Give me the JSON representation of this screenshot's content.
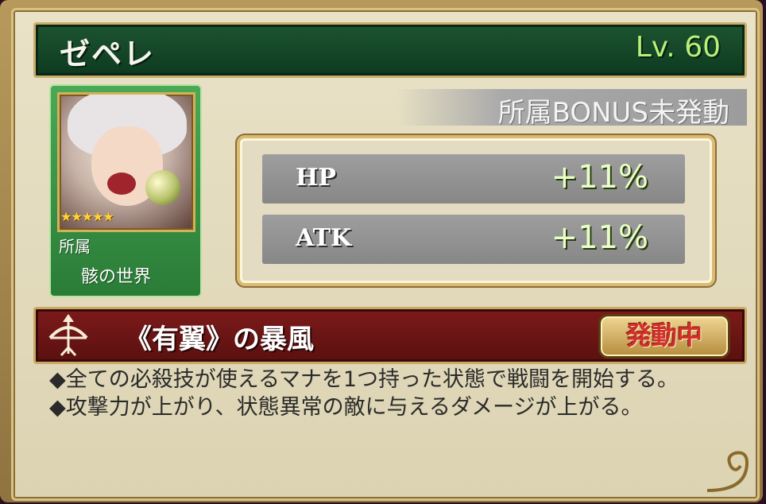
{
  "character": {
    "name": "ゼペレ",
    "level": "Lv. 60",
    "rarity_stars": "★★★★★",
    "affiliation_label": "所属",
    "affiliation_value": "骸の世界"
  },
  "bonus": {
    "status_text": "所属BONUS未発動",
    "stats": [
      {
        "label": "HP",
        "value": "+11%"
      },
      {
        "label": "ATK",
        "value": "+11%"
      }
    ]
  },
  "skill": {
    "icon": "bow-icon",
    "name": "《有翼》の暴風",
    "status_badge": "発動中",
    "description": [
      "◆全ての必殺技が使えるマナを1つ持った状態で戦闘を開始する。",
      "◆攻撃力が上がり、状態異常の敵に与えるダメージが上がる。"
    ]
  },
  "colors": {
    "name_bar": "#1d5431",
    "skill_bar": "#7c1a1a",
    "level_text": "#b8f07a",
    "badge_text": "#d2302a"
  }
}
